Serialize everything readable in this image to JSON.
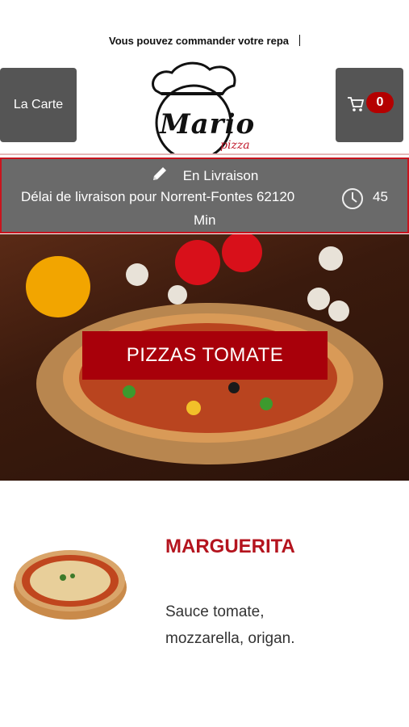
{
  "ticker": {
    "text": "Vous pouvez commander votre repa"
  },
  "header": {
    "menu_label": "La Carte",
    "cart_count": "0",
    "logo_text": "Mario",
    "logo_sub": "pizza"
  },
  "info": {
    "mode": "En Livraison",
    "delay_text": "Délai de livraison pour Norrent-Fontes 62120",
    "minutes": "45",
    "unit": "Min"
  },
  "hero": {
    "title": "PIZZAS TOMATE"
  },
  "product": {
    "name": "MARGUERITA",
    "description": "Sauce tomate, mozzarella, origan."
  },
  "colors": {
    "accent": "#b4141e",
    "button_bg": "#555555",
    "info_bg": "#6a6a6a"
  }
}
